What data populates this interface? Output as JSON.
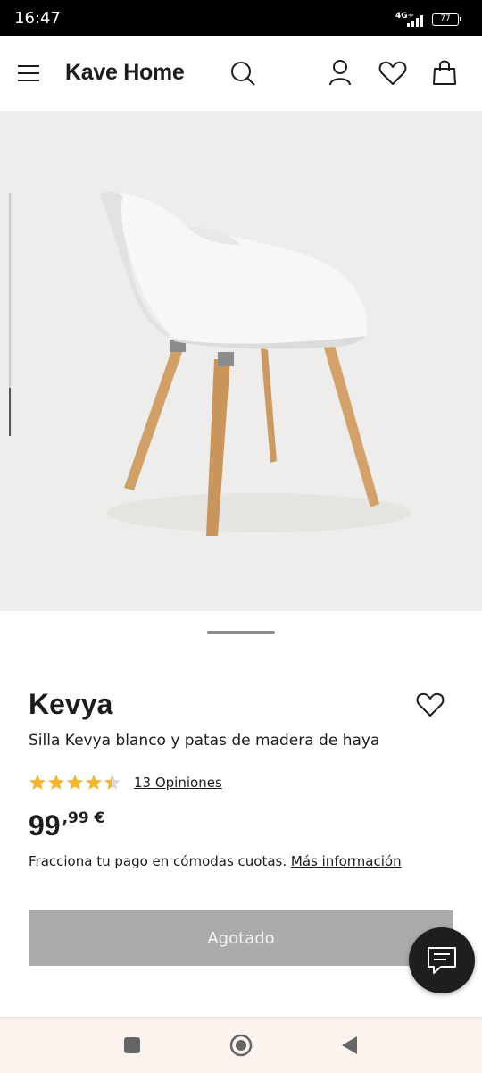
{
  "status_bar": {
    "time": "16:47",
    "network": "4G+",
    "battery": "77"
  },
  "header": {
    "logo": "Kave Home",
    "icons": [
      "menu-icon",
      "search-icon",
      "user-icon",
      "heart-icon",
      "shopping-bag-icon"
    ]
  },
  "gallery": {
    "image": "white-armchair-beech-legs",
    "background_color": "#eeedeb"
  },
  "product": {
    "name": "Kevya",
    "subtitle": "Silla Kevya blanco y patas de madera de haya",
    "rating": 4.5,
    "rating_max": 5,
    "reviews_label": "13 Opiniones",
    "price_integer": "99",
    "price_decimal": ",99 €",
    "financing_text": "Fracciona tu pago en cómodas cuotas.",
    "financing_link": "Más información",
    "button_label": "Agotado"
  },
  "colors": {
    "star": "#f2b531",
    "button_disabled": "#aaaaaa",
    "chat_button": "#1e1e1e"
  },
  "nav_bar": {
    "icons": [
      "recent-apps-icon",
      "home-icon",
      "back-icon"
    ]
  }
}
